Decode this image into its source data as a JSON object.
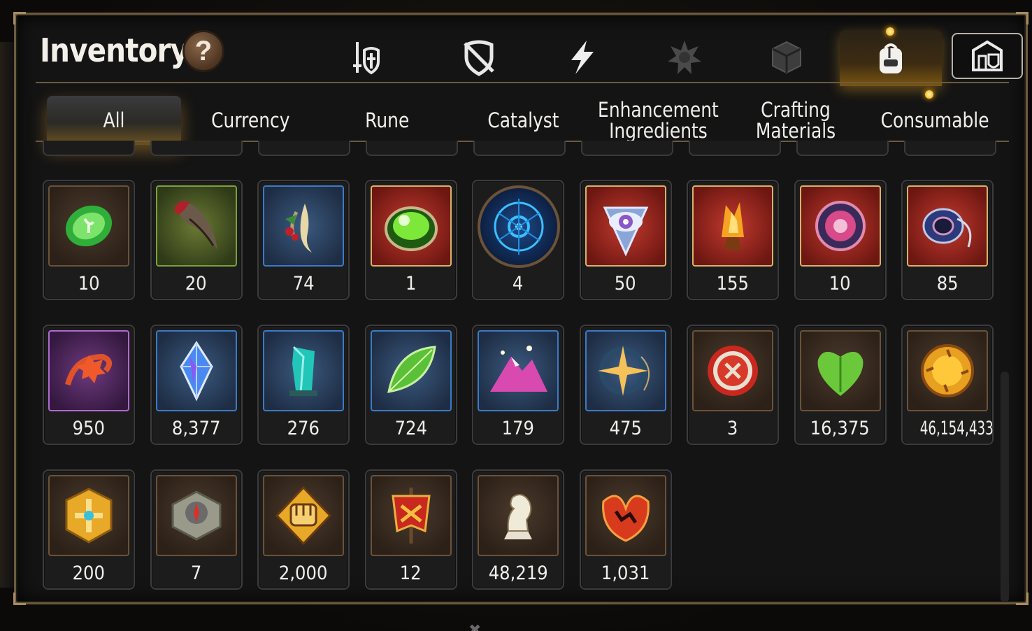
{
  "title": "Inventory",
  "help_label": "?",
  "category_tabs": [
    {
      "icon": "sword-shield-icon",
      "active": false
    },
    {
      "icon": "broken-shield-icon",
      "active": false
    },
    {
      "icon": "lightning-icon",
      "active": false
    },
    {
      "icon": "burst-emblem-icon",
      "active": false
    },
    {
      "icon": "cube-icon",
      "active": false
    },
    {
      "icon": "backpack-icon",
      "active": true
    },
    {
      "icon": "guild-castle-icon",
      "active": false
    }
  ],
  "sub_tabs": [
    {
      "label": "All",
      "active": true
    },
    {
      "label": "Currency",
      "active": false
    },
    {
      "label": "Rune",
      "active": false
    },
    {
      "label": "Catalyst",
      "active": false
    },
    {
      "label": "Enhancement Ingredients",
      "active": false
    },
    {
      "label": "Crafting Materials",
      "active": false
    },
    {
      "label": "Consumable",
      "active": false
    }
  ],
  "items": [
    {
      "icon": "green-stone-icon",
      "qty": "10"
    },
    {
      "icon": "claw-icon",
      "qty": "20"
    },
    {
      "icon": "ginseng-root-icon",
      "qty": "74"
    },
    {
      "icon": "green-orb-icon",
      "qty": "1"
    },
    {
      "icon": "blue-rune-circle-icon",
      "qty": "4"
    },
    {
      "icon": "eye-emblem-icon",
      "qty": "50"
    },
    {
      "icon": "flame-crystal-icon",
      "qty": "155"
    },
    {
      "icon": "pink-disc-icon",
      "qty": "10"
    },
    {
      "icon": "blue-pendant-icon",
      "qty": "85"
    },
    {
      "icon": "red-flower-ring-icon",
      "qty": "950"
    },
    {
      "icon": "blue-gem-icon",
      "qty": "8,377"
    },
    {
      "icon": "teal-crystal-icon",
      "qty": "276"
    },
    {
      "icon": "leaf-icon",
      "qty": "724"
    },
    {
      "icon": "pink-mountain-icon",
      "qty": "179"
    },
    {
      "icon": "star-compass-icon",
      "qty": "475"
    },
    {
      "icon": "red-medal-icon",
      "qty": "3"
    },
    {
      "icon": "green-heart-icon",
      "qty": "16,375"
    },
    {
      "icon": "gold-coin-icon",
      "qty": "46,154,433"
    },
    {
      "icon": "gold-crest-icon",
      "qty": "200"
    },
    {
      "icon": "stone-compass-icon",
      "qty": "7"
    },
    {
      "icon": "fist-badge-icon",
      "qty": "2,000"
    },
    {
      "icon": "war-banner-icon",
      "qty": "12"
    },
    {
      "icon": "chess-knight-icon",
      "qty": "48,219"
    },
    {
      "icon": "red-leaf-icon",
      "qty": "1,031"
    }
  ],
  "colors": {
    "panel_border": "#6d5a3e",
    "accent_gold": "#f5a300",
    "text": "#f1efe9"
  }
}
